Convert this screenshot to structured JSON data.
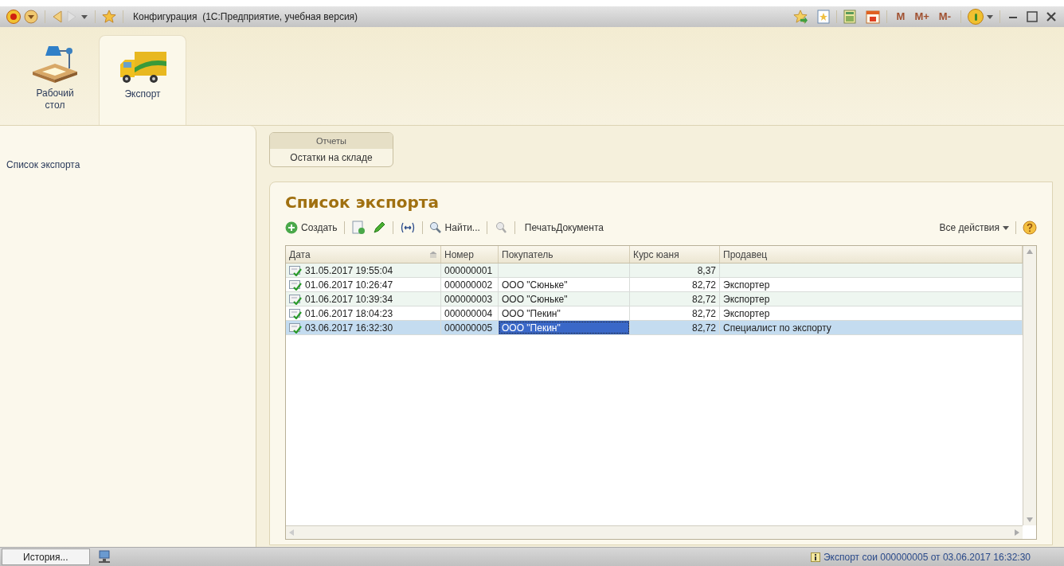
{
  "window": {
    "title": "Конфигурация  (1С:Предприятие, учебная версия)",
    "memory_buttons": [
      "M",
      "M+",
      "M-"
    ]
  },
  "sections": [
    {
      "label": "Рабочий стол",
      "kind": "desk",
      "selected": false
    },
    {
      "label": "Экспорт",
      "kind": "truck",
      "selected": true
    }
  ],
  "navigation": {
    "items": [
      {
        "label": "Список экспорта"
      }
    ]
  },
  "reports": {
    "title": "Отчеты",
    "items": [
      "Остатки на складе"
    ]
  },
  "form": {
    "title": "Список экспорта",
    "toolbar": {
      "create": "Создать",
      "find": "Найти...",
      "print": "ПечатьДокумента",
      "all_actions": "Все действия"
    },
    "table": {
      "columns": [
        {
          "label": "Дата",
          "kind": "text",
          "sorted": true
        },
        {
          "label": "Номер",
          "kind": "text",
          "sorted": false
        },
        {
          "label": "Покупатель",
          "kind": "text",
          "sorted": false
        },
        {
          "label": "Курс юаня",
          "kind": "number",
          "sorted": false
        },
        {
          "label": "Продавец",
          "kind": "text",
          "sorted": false
        }
      ],
      "rows": [
        {
          "selected": false,
          "posted": true,
          "cells": [
            {
              "text": "31.05.2017 19:55:04",
              "focused": false
            },
            {
              "text": "000000001",
              "focused": false
            },
            {
              "focused": false
            },
            {
              "text": "8,37",
              "focused": false
            },
            {
              "focused": false
            }
          ]
        },
        {
          "selected": false,
          "posted": true,
          "cells": [
            {
              "text": "01.06.2017 10:26:47",
              "focused": false
            },
            {
              "text": "000000002",
              "focused": false
            },
            {
              "text": "ООО \"Сюньке\"",
              "focused": false
            },
            {
              "text": "82,72",
              "focused": false
            },
            {
              "text": "Экспортер",
              "focused": false
            }
          ]
        },
        {
          "selected": false,
          "posted": true,
          "cells": [
            {
              "text": "01.06.2017 10:39:34",
              "focused": false
            },
            {
              "text": "000000003",
              "focused": false
            },
            {
              "text": "ООО \"Сюньке\"",
              "focused": false
            },
            {
              "text": "82,72",
              "focused": false
            },
            {
              "text": "Экспортер",
              "focused": false
            }
          ]
        },
        {
          "selected": false,
          "posted": true,
          "cells": [
            {
              "text": "01.06.2017 18:04:23",
              "focused": false
            },
            {
              "text": "000000004",
              "focused": false
            },
            {
              "text": "ООО \"Пекин\"",
              "focused": false
            },
            {
              "text": "82,72",
              "focused": false
            },
            {
              "text": "Экспортер",
              "focused": false
            }
          ]
        },
        {
          "selected": true,
          "posted": true,
          "cells": [
            {
              "text": "03.06.2017 16:32:30",
              "focused": false
            },
            {
              "text": "000000005",
              "focused": false
            },
            {
              "text": "ООО \"Пекин\"",
              "focused": true
            },
            {
              "text": "82,72",
              "focused": false
            },
            {
              "text": "Специалист по экспорту",
              "focused": false
            }
          ]
        }
      ]
    }
  },
  "status_bar": {
    "history": "История...",
    "message": "Экспорт сои 000000005 от 03.06.2017 16:32:30"
  }
}
